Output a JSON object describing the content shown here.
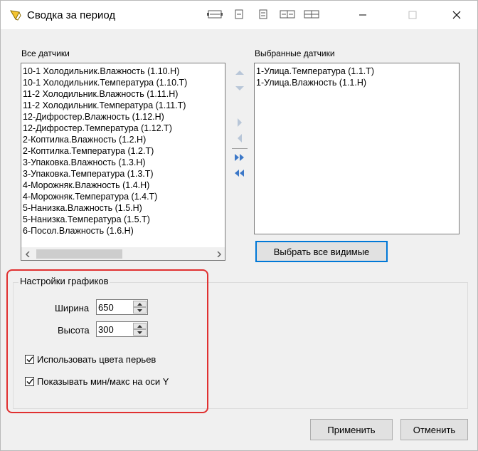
{
  "window": {
    "title": "Сводка за период"
  },
  "toolbar_icons": [
    "layout-wide-icon",
    "layout-single-icon",
    "layout-split-icon",
    "layout-double-icon",
    "layout-quad-icon"
  ],
  "all_sensors": {
    "label": "Все датчики",
    "items": [
      "10-1 Холодильник.Влажность (1.10.Н)",
      "10-1 Холодильник.Температура (1.10.Т)",
      "11-2 Холодильник.Влажность (1.11.Н)",
      "11-2 Холодильник.Температура (1.11.Т)",
      "12-Дифростер.Влажность (1.12.Н)",
      "12-Дифростер.Температура (1.12.Т)",
      "2-Коптилка.Влажность (1.2.Н)",
      "2-Коптилка.Температура (1.2.Т)",
      "3-Упаковка.Влажность (1.3.Н)",
      "3-Упаковка.Температура (1.3.Т)",
      "4-Морожняк.Влажность (1.4.Н)",
      "4-Морожняк.Температура (1.4.Т)",
      "5-Нанизка.Влажность (1.5.Н)",
      "5-Нанизка.Температура (1.5.Т)",
      "6-Посол.Влажность (1.6.Н)"
    ]
  },
  "selected_sensors": {
    "label": "Выбранные датчики",
    "items": [
      "1-Улица.Температура (1.1.Т)",
      "1-Улица.Влажность (1.1.Н)"
    ]
  },
  "select_all_visible_label": "Выбрать все видимые",
  "chart_settings": {
    "title": "Настройки графиков",
    "width_label": "Ширина",
    "width_value": "650",
    "height_label": "Высота",
    "height_value": "300",
    "use_pen_colors_label": "Использовать цвета перьев",
    "use_pen_colors_checked": true,
    "show_minmax_label": "Показывать мин/макс на оси Y",
    "show_minmax_checked": true
  },
  "apply_label": "Применить",
  "cancel_label": "Отменить",
  "colors": {
    "highlight": "#e03030",
    "focus": "#0078d7",
    "disabled_arrow": "#b8c6d8",
    "active_arrow": "#3c78c8"
  }
}
